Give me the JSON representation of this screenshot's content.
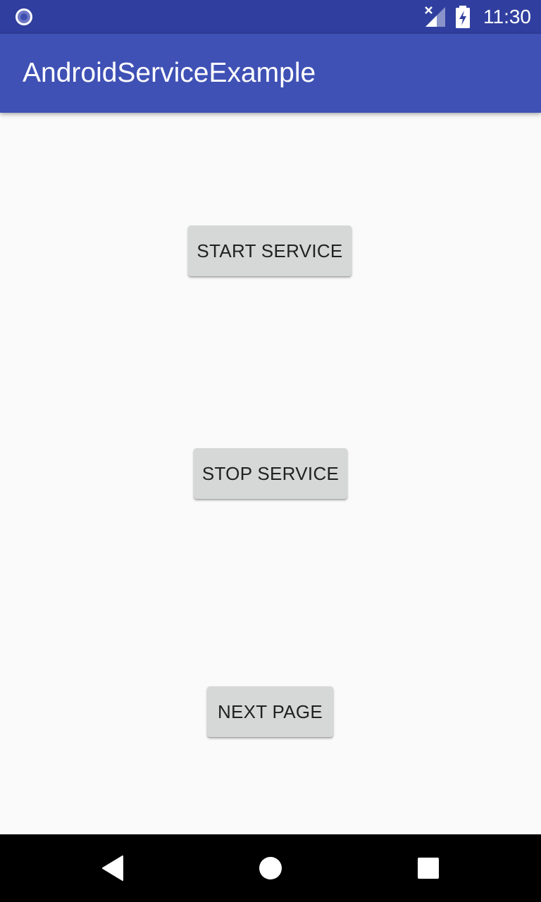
{
  "status_bar": {
    "time": "11:30",
    "notification_icon": "circle-notification-icon",
    "signal_icon": "no-signal-icon",
    "battery_icon": "battery-charging-icon",
    "background_color": "#303f9f"
  },
  "app_bar": {
    "title": "AndroidServiceExample",
    "background_color": "#3f51b5"
  },
  "main": {
    "buttons": [
      {
        "label": "START SERVICE"
      },
      {
        "label": "STOP SERVICE"
      },
      {
        "label": "NEXT PAGE"
      }
    ],
    "button_color": "#d6d7d7"
  },
  "nav_bar": {
    "back_icon": "back-triangle-icon",
    "home_icon": "home-circle-icon",
    "recents_icon": "recents-square-icon"
  }
}
